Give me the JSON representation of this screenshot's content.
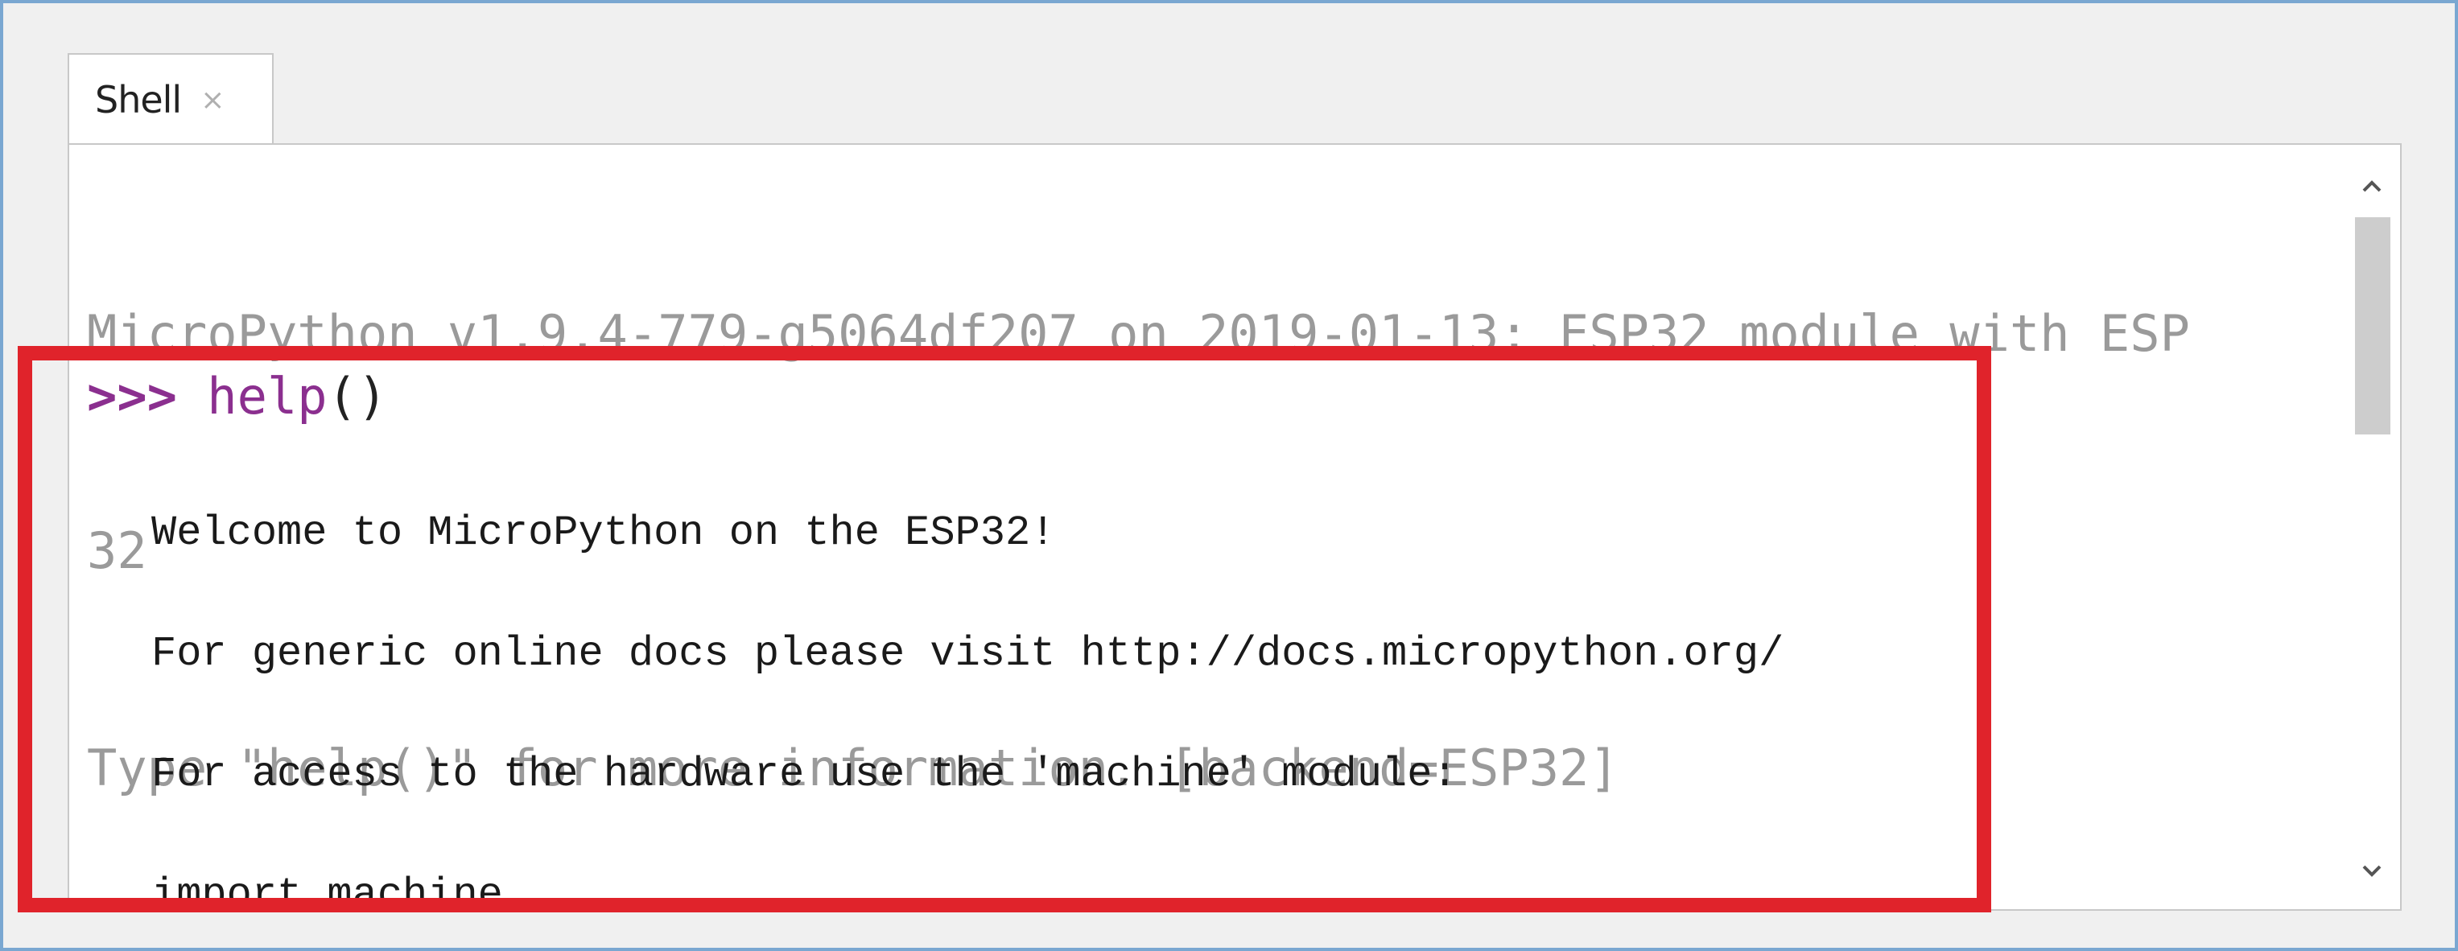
{
  "tab": {
    "label": "Shell",
    "close_glyph": "×"
  },
  "shell": {
    "banner_lines": [
      "MicroPython v1.9.4-779-g5064df207 on 2019-01-13; ESP32 module with ESP",
      "32",
      "Type \"help()\" for more information. [backend=ESP32]"
    ],
    "prompt": {
      "symbol": ">>>",
      "command": " help",
      "parens": "()"
    },
    "output_lines": [
      "Welcome to MicroPython on the ESP32!",
      "For generic online docs please visit http://docs.micropython.org/",
      "For access to the hardware use the 'machine' module:",
      "import machine"
    ]
  },
  "scrollbar": {
    "up_icon": "chevron-up-icon",
    "down_icon": "chevron-down-icon"
  },
  "colors": {
    "banner_text": "#9a9a9a",
    "prompt": "#8b2f8f",
    "highlight": "#e0232b",
    "frame": "#7aa7d1"
  }
}
